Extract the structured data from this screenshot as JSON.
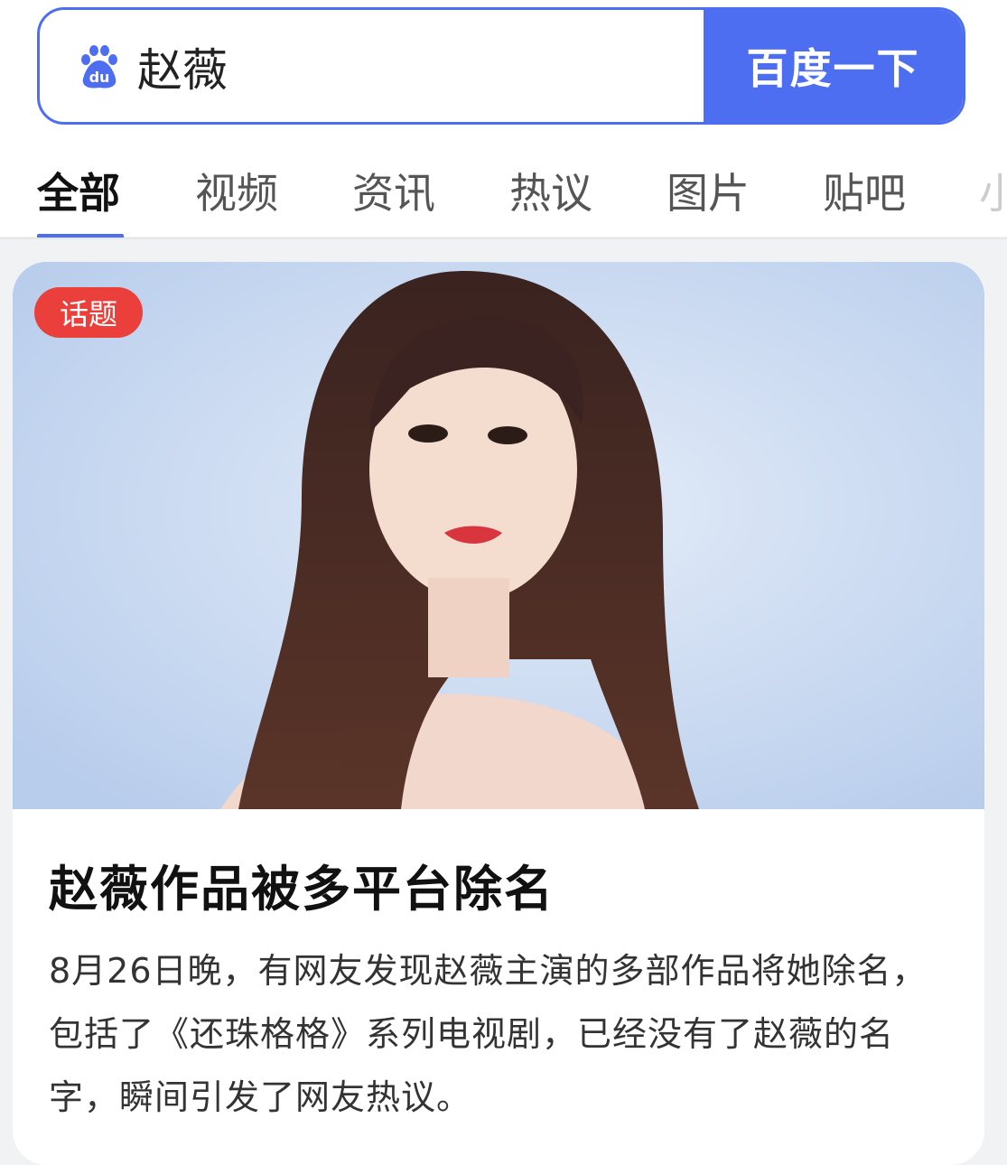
{
  "search": {
    "query": "赵薇",
    "button_label": "百度一下",
    "logo_text": "du"
  },
  "tabs": [
    {
      "label": "全部",
      "active": true
    },
    {
      "label": "视频"
    },
    {
      "label": "资讯"
    },
    {
      "label": "热议"
    },
    {
      "label": "图片"
    },
    {
      "label": "贴吧"
    },
    {
      "label": "小"
    }
  ],
  "card": {
    "badge": "话题",
    "title": "赵薇作品被多平台除名",
    "summary": "8月26日晚，有网友发现赵薇主演的多部作品将她除名，包括了《还珠格格》系列电视剧，已经没有了赵薇的名字，瞬间引发了网友热议。"
  },
  "colors": {
    "accent": "#4e6ef2",
    "badge": "#ea3f3a"
  }
}
